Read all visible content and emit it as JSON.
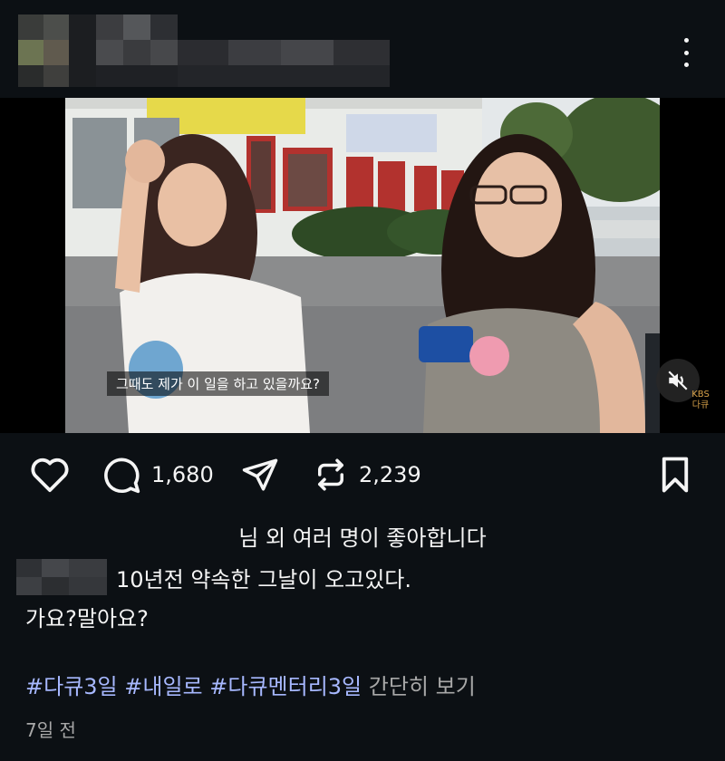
{
  "post": {
    "video": {
      "subtitle": "그때도 제가 이 일을 하고 있을까요?",
      "watermark_line1": "KBS",
      "watermark_line2": "다큐"
    },
    "actions": {
      "like_icon": "heart-icon",
      "comment_icon": "comment-icon",
      "comment_count": "1,680",
      "share_icon": "send-icon",
      "repost_icon": "repost-icon",
      "repost_count": "2,239",
      "save_icon": "bookmark-icon",
      "mute_icon": "speaker-muted-icon"
    },
    "likes_text": "님 외 여러 명이 좋아합니다",
    "caption": {
      "line1": "10년전 약속한 그날이 오고있다.",
      "line2": "가요?말아요?"
    },
    "hashtags": [
      "#다큐3일",
      "#내일로",
      "#다큐멘터리3일"
    ],
    "more_label": "간단히 보기",
    "time_ago": "7일 전"
  },
  "colors": {
    "background": "#0c1014",
    "text": "#f5f5f5",
    "hashtag": "#a7b8ff",
    "secondary": "#a8a8a8"
  }
}
